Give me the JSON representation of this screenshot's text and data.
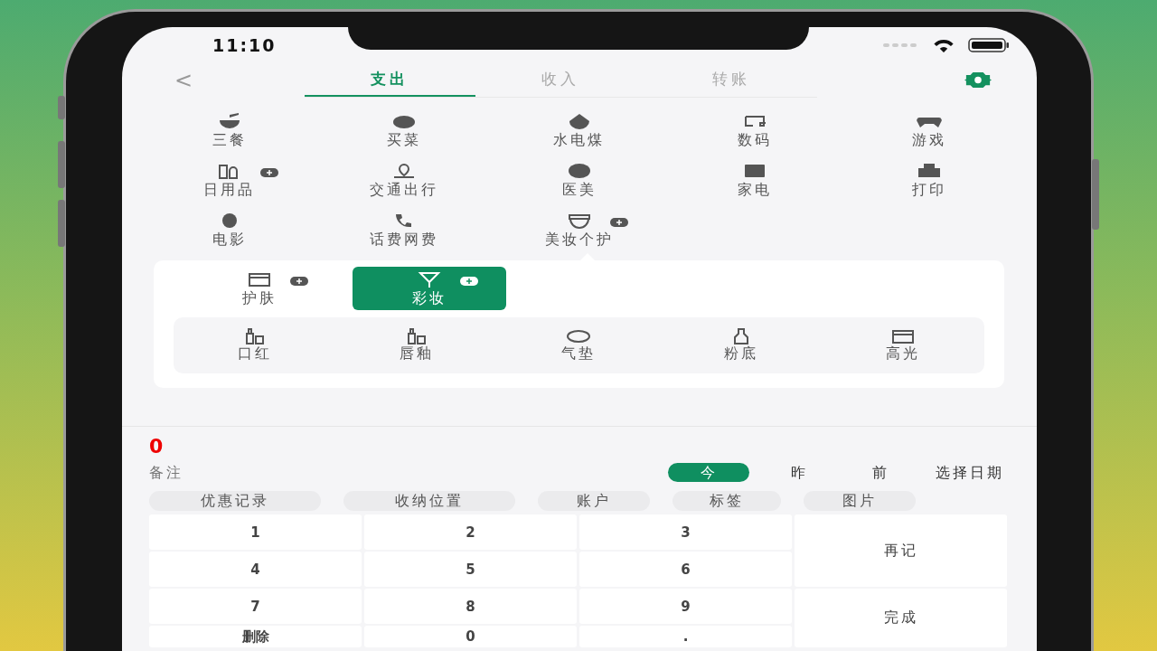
{
  "status_bar": {
    "time": "11:10"
  },
  "header": {
    "back": "<",
    "tabs": [
      {
        "label": "支出",
        "selected": true
      },
      {
        "label": "收入",
        "selected": false
      },
      {
        "label": "转账",
        "selected": false
      }
    ]
  },
  "categories": [
    {
      "label": "三餐",
      "expandable": false
    },
    {
      "label": "买菜",
      "expandable": false
    },
    {
      "label": "水电煤",
      "expandable": false
    },
    {
      "label": "数码",
      "expandable": false
    },
    {
      "label": "游戏",
      "expandable": false
    },
    {
      "label": "日用品",
      "expandable": true
    },
    {
      "label": "交通出行",
      "expandable": false
    },
    {
      "label": "医美",
      "expandable": false
    },
    {
      "label": "家电",
      "expandable": false
    },
    {
      "label": "打印",
      "expandable": false
    },
    {
      "label": "电影",
      "expandable": false
    },
    {
      "label": "话费网费",
      "expandable": false
    },
    {
      "label": "美妆个护",
      "expandable": true
    }
  ],
  "subcategories": [
    {
      "label": "护肤",
      "expandable": true,
      "selected": false
    },
    {
      "label": "彩妆",
      "expandable": true,
      "selected": true
    }
  ],
  "items": [
    "口红",
    "唇釉",
    "气垫",
    "粉底",
    "高光"
  ],
  "amount": "0",
  "note": {
    "placeholder": "备注"
  },
  "dates": [
    {
      "label": "今",
      "selected": true
    },
    {
      "label": "昨",
      "selected": false
    },
    {
      "label": "前",
      "selected": false
    },
    {
      "label": "选择日期",
      "selected": false
    }
  ],
  "chips": [
    "优惠记录",
    "收纳位置",
    "账户",
    "标签",
    "图片"
  ],
  "keypad": {
    "keys": [
      "1",
      "2",
      "3",
      "4",
      "5",
      "6",
      "7",
      "8",
      "9",
      "删除",
      "0",
      "."
    ],
    "again": "再记",
    "done": "完成"
  }
}
